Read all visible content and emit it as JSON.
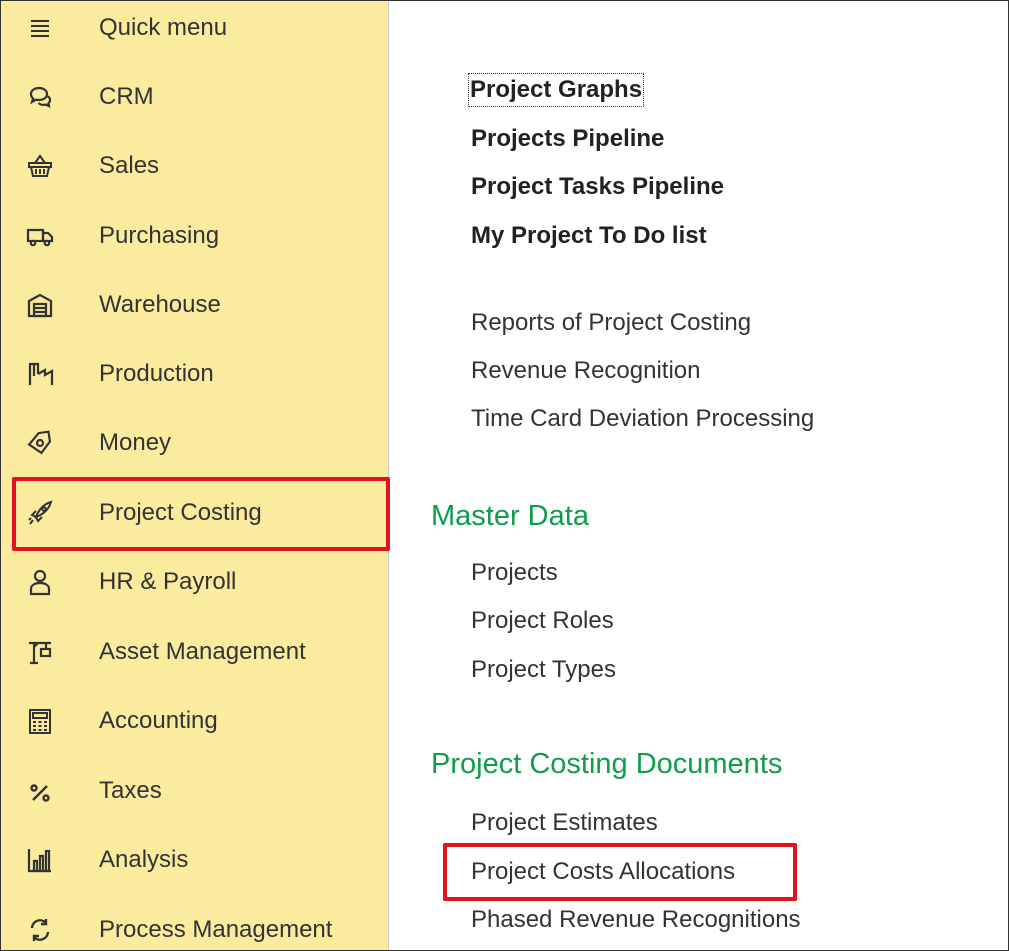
{
  "sidebar": {
    "items": [
      {
        "label": "Quick menu",
        "icon": "menu-icon"
      },
      {
        "label": "CRM",
        "icon": "chat-bubble-icon"
      },
      {
        "label": "Sales",
        "icon": "basket-icon"
      },
      {
        "label": "Purchasing",
        "icon": "truck-icon"
      },
      {
        "label": "Warehouse",
        "icon": "warehouse-icon"
      },
      {
        "label": "Production",
        "icon": "factory-icon"
      },
      {
        "label": "Money",
        "icon": "money-tag-icon"
      },
      {
        "label": "Project Costing",
        "icon": "rocket-icon",
        "selected": true
      },
      {
        "label": "HR & Payroll",
        "icon": "person-icon"
      },
      {
        "label": "Asset Management",
        "icon": "crane-icon"
      },
      {
        "label": "Accounting",
        "icon": "calculator-icon"
      },
      {
        "label": "Taxes",
        "icon": "percent-icon"
      },
      {
        "label": "Analysis",
        "icon": "bar-chart-icon"
      },
      {
        "label": "Process Management",
        "icon": "cycle-arrows-icon"
      }
    ]
  },
  "main": {
    "top_links": [
      "Project Graphs",
      "Projects Pipeline",
      "Project Tasks Pipeline",
      "My Project To Do list"
    ],
    "report_links": [
      "Reports of Project Costing",
      "Revenue Recognition",
      "Time Card Deviation Processing"
    ],
    "master_data": {
      "title": "Master Data",
      "links": [
        "Projects",
        "Project Roles",
        "Project Types"
      ]
    },
    "documents": {
      "title": "Project Costing Documents",
      "links": [
        "Project Estimates",
        "Project Costs Allocations",
        "Phased Revenue Recognitions"
      ]
    }
  },
  "colors": {
    "sidebar_bg": "#fbeb9f",
    "section_title": "#0e9e4a",
    "highlight_box": "#e0141e",
    "text": "#333333"
  }
}
